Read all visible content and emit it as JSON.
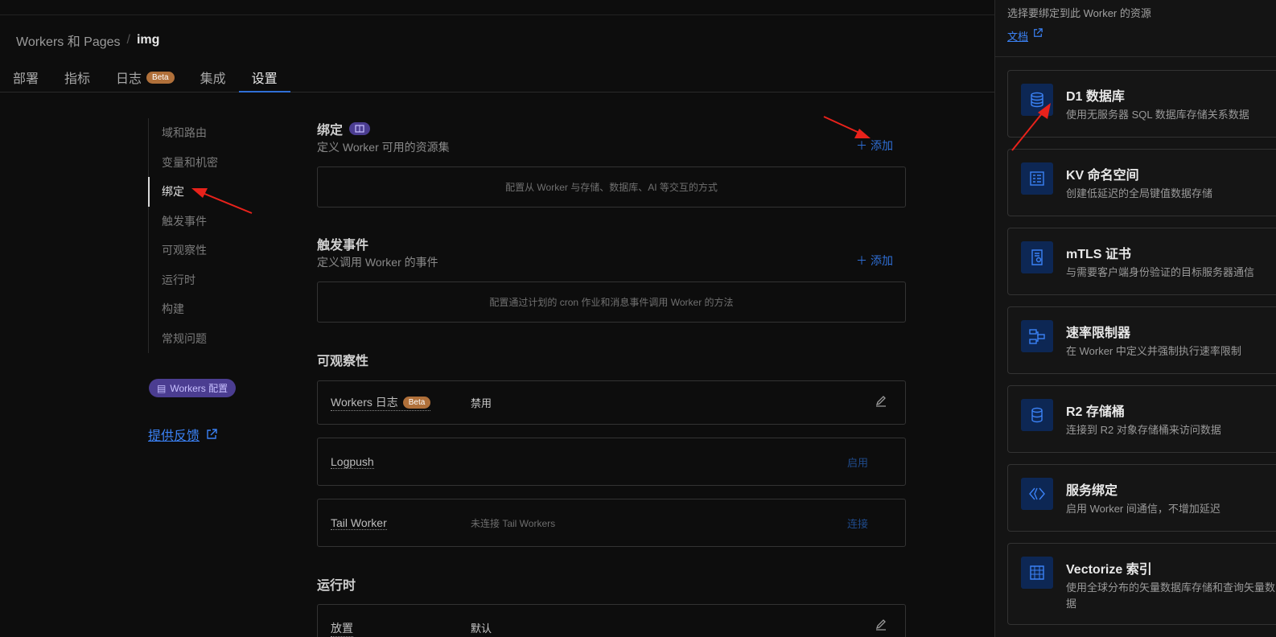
{
  "breadcrumb": {
    "parent": "Workers 和 Pages",
    "sep": "/",
    "current": "img"
  },
  "tabs": [
    {
      "label": "部署"
    },
    {
      "label": "指标"
    },
    {
      "label": "日志",
      "badge": "Beta"
    },
    {
      "label": "集成"
    },
    {
      "label": "设置",
      "active": true
    }
  ],
  "sidenav": {
    "items": [
      "域和路由",
      "变量和机密",
      "绑定",
      "触发事件",
      "可观察性",
      "运行时",
      "构建",
      "常规问题"
    ],
    "active": "绑定"
  },
  "config_pill": "Workers 配置",
  "feedback": "提供反馈",
  "bindings": {
    "title": "绑定",
    "desc": "定义 Worker 可用的资源集",
    "add": "添加",
    "empty": "配置从 Worker 与存储、数据库、AI 等交互的方式"
  },
  "triggers": {
    "title": "触发事件",
    "desc": "定义调用 Worker 的事件",
    "add": "添加",
    "empty": "配置通过计划的 cron 作业和消息事件调用 Worker 的方法"
  },
  "observability": {
    "title": "可观察性",
    "rows": [
      {
        "label": "Workers 日志",
        "badge": "Beta",
        "value": "禁用"
      },
      {
        "label": "Logpush",
        "action": "启用"
      },
      {
        "label": "Tail Worker",
        "value": "未连接 Tail Workers",
        "action": "连接"
      }
    ]
  },
  "runtime": {
    "title": "运行时",
    "row_label": "放置",
    "row_value": "默认"
  },
  "panel": {
    "header": "选择要绑定到此 Worker 的资源",
    "doc": "文档",
    "cards": [
      {
        "title": "D1 数据库",
        "desc": "使用无服务器 SQL 数据库存储关系数据",
        "icon": "database-icon"
      },
      {
        "title": "KV 命名空间",
        "desc": "创建低延迟的全局键值数据存储",
        "icon": "kv-icon"
      },
      {
        "title": "mTLS 证书",
        "desc": "与需要客户端身份验证的目标服务器通信",
        "icon": "certificate-icon"
      },
      {
        "title": "速率限制器",
        "desc": "在 Worker 中定义并强制执行速率限制",
        "icon": "rate-limit-icon"
      },
      {
        "title": "R2 存储桶",
        "desc": "连接到 R2 对象存储桶来访问数据",
        "icon": "bucket-icon"
      },
      {
        "title": "服务绑定",
        "desc": "启用 Worker 间通信，不增加延迟",
        "icon": "service-icon"
      },
      {
        "title": "Vectorize 索引",
        "desc": "使用全球分布的矢量数据库存储和查询矢量数据",
        "icon": "vector-icon"
      }
    ]
  },
  "colors": {
    "accent": "#2f6fd6",
    "beta": "#b0703a",
    "purple": "#4b3d91",
    "annotation": "#e8221b"
  }
}
